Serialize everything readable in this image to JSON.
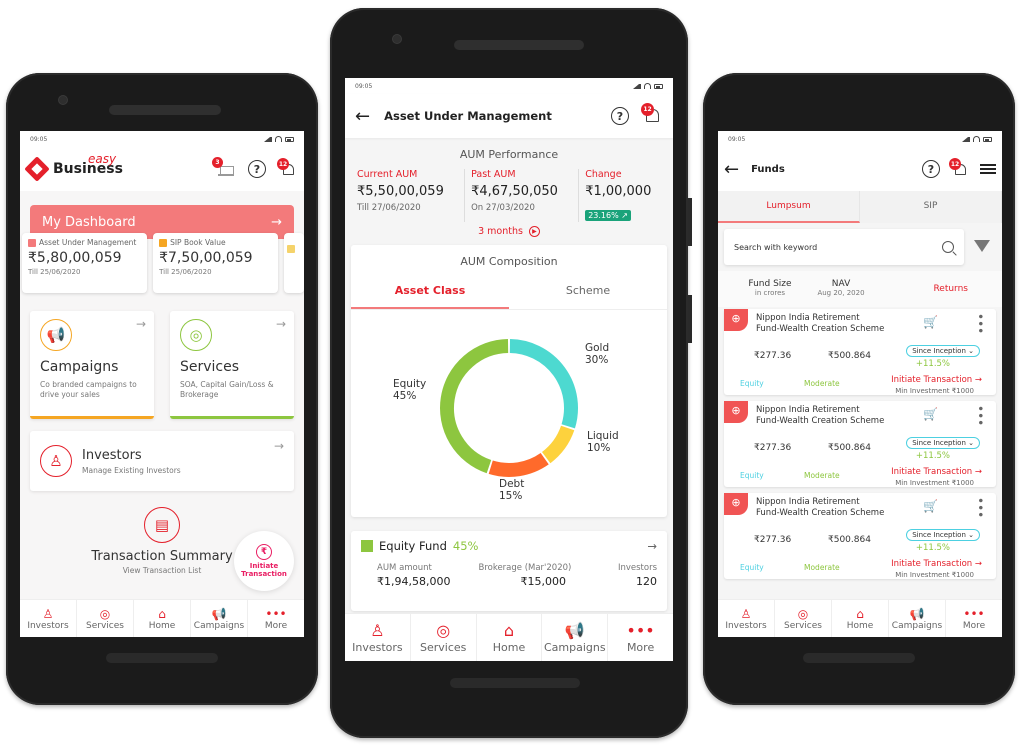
{
  "status_time": "09:05",
  "bottom_nav": [
    {
      "icon": "investors-icon",
      "label": "Investors"
    },
    {
      "icon": "services-icon",
      "label": "Services"
    },
    {
      "icon": "home-icon",
      "label": "Home"
    },
    {
      "icon": "campaigns-icon",
      "label": "Campaigns"
    },
    {
      "icon": "more-icon",
      "label": "More"
    }
  ],
  "home": {
    "logo_text": "Business",
    "logo_accent": "easy",
    "birthday_badge": "3",
    "notification_badge": "12",
    "dashboard_label": "My Dashboard",
    "kpis": [
      {
        "label": "Asset Under Management",
        "value": "₹5,80,00,059",
        "sub": "Till 25/06/2020"
      },
      {
        "label": "SIP Book Value",
        "value": "₹7,50,00,059",
        "sub": "Till 25/06/2020"
      }
    ],
    "tiles": [
      {
        "title": "Campaigns",
        "desc": "Co branded campaigns to drive your sales",
        "color": "#f5a623"
      },
      {
        "title": "Services",
        "desc": "SOA, Capital Gain/Loss & Brokerage",
        "color": "#8dc63f"
      }
    ],
    "investors": {
      "title": "Investors",
      "desc": "Manage Existing Investors"
    },
    "transaction": {
      "title": "Transaction Summary",
      "desc": "View Transaction List"
    },
    "fab": {
      "line1": "Initiate",
      "line2": "Transaction"
    }
  },
  "aum": {
    "title": "Asset Under Management",
    "notification_badge": "12",
    "performance_title": "AUM Performance",
    "current": {
      "label": "Current AUM",
      "value": "₹5,50,00,059",
      "sub": "Till 27/06/2020"
    },
    "past": {
      "label": "Past AUM",
      "value": "₹4,67,50,050",
      "sub": "On 27/03/2020"
    },
    "change": {
      "label": "Change",
      "value": "₹1,00,000",
      "pct": "23.16% ↗"
    },
    "period": "3 months",
    "composition_title": "AUM Composition",
    "tabs": [
      "Asset Class",
      "Scheme"
    ],
    "fund": {
      "name": "Equity Fund",
      "pct": "45%",
      "cols": [
        "AUM amount",
        "Brokerage (Mar'2020)",
        "Investors"
      ],
      "vals": [
        "₹1,94,58,000",
        "₹15,000",
        "120"
      ]
    }
  },
  "chart_data": {
    "type": "pie",
    "title": "AUM Composition",
    "categories": [
      "Gold",
      "Liquid",
      "Debt",
      "Equity"
    ],
    "values": [
      30,
      10,
      15,
      45
    ],
    "colors": [
      "#4dd9d0",
      "#fdd23d",
      "#ff6a2b",
      "#8dc63f"
    ],
    "labels": [
      "Gold 30%",
      "Liquid 10%",
      "Debt 15%",
      "Equity 45%"
    ]
  },
  "funds": {
    "title": "Funds",
    "notification_badge": "12",
    "tabs": [
      "Lumpsum",
      "SIP"
    ],
    "search_placeholder": "Search with keyword",
    "col_fund_size": "Fund Size",
    "col_fund_size_sub": "in crores",
    "col_nav": "NAV",
    "col_nav_sub": "Aug 20, 2020",
    "col_returns": "Returns",
    "items": [
      {
        "name1": "Nippon India Retirement",
        "name2": "Fund-Wealth Creation Scheme",
        "size": "₹277.36",
        "nav": "₹500.864",
        "period": "Since Inception ⌄",
        "ret": "+11.5%",
        "cat": "Equity",
        "risk": "Moderate",
        "action": "Initiate Transaction →",
        "min": "Min Investment ₹1000"
      },
      {
        "name1": "Nippon India Retirement",
        "name2": "Fund-Wealth Creation Scheme",
        "size": "₹277.36",
        "nav": "₹500.864",
        "period": "Since Inception ⌄",
        "ret": "+11.5%",
        "cat": "Equity",
        "risk": "Moderate",
        "action": "Initiate Transaction →",
        "min": "Min Investment ₹1000"
      },
      {
        "name1": "Nippon India Retirement",
        "name2": "Fund-Wealth Creation Scheme",
        "size": "₹277.36",
        "nav": "₹500.864",
        "period": "Since Inception ⌄",
        "ret": "+11.5%",
        "cat": "Equity",
        "risk": "Moderate",
        "action": "Initiate Transaction →",
        "min": "Min Investment ₹1000"
      }
    ]
  }
}
